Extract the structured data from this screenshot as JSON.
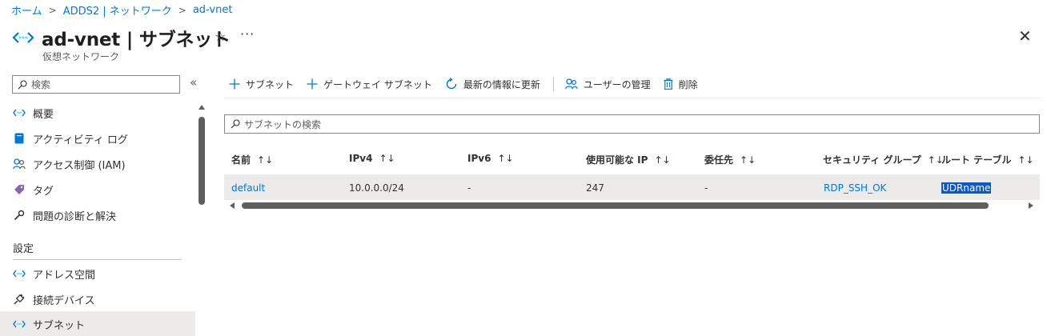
{
  "breadcrumb": {
    "items": [
      "ホーム",
      "ADDS2 | ネットワーク",
      "ad-vnet"
    ],
    "separator": ">"
  },
  "header": {
    "title": "ad-vnet | サブネット",
    "subtitle": "仮想ネットワーク",
    "favorite_icon": "star-icon",
    "more_label": "···",
    "close_label": "✕"
  },
  "sidebar": {
    "search_placeholder": "検索",
    "collapse_label": "«",
    "items": [
      {
        "label": "概要",
        "icon": "vnet-icon"
      },
      {
        "label": "アクティビティ ログ",
        "icon": "log-icon"
      },
      {
        "label": "アクセス制御 (IAM)",
        "icon": "people-icon"
      },
      {
        "label": "タグ",
        "icon": "tag-icon"
      },
      {
        "label": "問題の診断と解決",
        "icon": "wrench-icon"
      }
    ],
    "section": "設定",
    "settings_items": [
      {
        "label": "アドレス空間",
        "icon": "vnet-icon"
      },
      {
        "label": "接続デバイス",
        "icon": "plug-icon"
      },
      {
        "label": "サブネット",
        "icon": "vnet-icon",
        "active": true
      }
    ]
  },
  "toolbar": {
    "add_subnet": "サブネット",
    "add_gateway_subnet": "ゲートウェイ サブネット",
    "refresh": "最新の情報に更新",
    "manage_users": "ユーザーの管理",
    "delete": "削除"
  },
  "main": {
    "search_placeholder": "サブネットの検索"
  },
  "table": {
    "sort_label": "↑↓",
    "columns": [
      "名前",
      "IPv4",
      "IPv6",
      "使用可能な IP",
      "委任先",
      "セキュリティ グループ",
      "ルート テーブル"
    ],
    "rows": [
      {
        "name": "default",
        "ipv4": "10.0.0.0/24",
        "ipv6": "-",
        "available_ip": "247",
        "delegated": "-",
        "nsg": "RDP_SSH_OK",
        "route_table": "UDRname"
      }
    ]
  },
  "colors": {
    "accent": "#0078d4",
    "selection": "#0b57d0",
    "row_bg": "#edebe9",
    "tag_purple": "#8764b8"
  }
}
